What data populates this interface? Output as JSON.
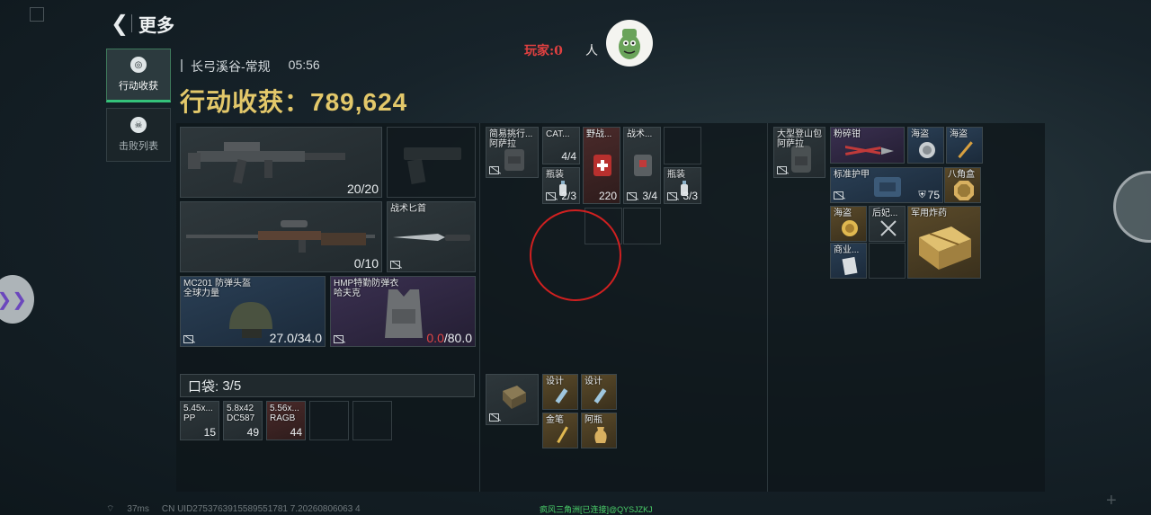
{
  "header": {
    "title": "更多",
    "back_icon": "back-chevron-icon"
  },
  "tabs": [
    {
      "label": "行动收获",
      "icon": "coin-icon",
      "active": true
    },
    {
      "label": "击败列表",
      "icon": "skull-icon",
      "active": false
    }
  ],
  "map_info": {
    "map_name": "长弓溪谷-常规",
    "time": "05:56"
  },
  "haul": {
    "label": "行动收获：",
    "value": "789,624"
  },
  "overlay": {
    "player_label": "玩家:0",
    "player_label2": "人"
  },
  "equipment": {
    "primary_weapon": {
      "count": "20/20"
    },
    "secondary_weapon": {
      "count": ""
    },
    "sniper": {
      "count": "0/10"
    },
    "melee": {
      "name": "战术匕首"
    },
    "helmet": {
      "name_line1": "MC201 防弹头盔",
      "name_line2": "全球力量",
      "durability": "27.0/34.0"
    },
    "armor": {
      "name_line1": "HMP特勤防弹衣",
      "name_line2": "哈夫克",
      "durability_current": "0.0",
      "durability_max": "/80.0"
    }
  },
  "pocket": {
    "label": "口袋:",
    "count": "3/5",
    "items": [
      {
        "name": "5.45x...",
        "sub": "PP",
        "count": "15"
      },
      {
        "name": "5.8x42",
        "sub": "DC587",
        "count": "49"
      },
      {
        "name": "5.56x...",
        "sub": "RAGB",
        "count": "44"
      }
    ]
  },
  "rig": {
    "container_name": "简易挑行...",
    "container_sub": "阿萨拉",
    "items": [
      {
        "name": "CAT...",
        "count": "4/4"
      },
      {
        "name": "野战...",
        "count": "220"
      },
      {
        "name": "战术...",
        "count": "3/4"
      },
      {
        "name": "瓶装",
        "count": "2/3"
      },
      {
        "name": "瓶装",
        "count": "3/3"
      }
    ]
  },
  "safe_box": {
    "items": [
      {
        "name": "设计"
      },
      {
        "name": "设计"
      },
      {
        "name": "金笔"
      },
      {
        "name": "阿瓶"
      }
    ]
  },
  "backpack": {
    "container_name": "大型登山包",
    "container_sub": "阿萨拉",
    "items": [
      {
        "name": "粉碎钳"
      },
      {
        "name": "海盗"
      },
      {
        "name": "海盗"
      },
      {
        "name": "标准护甲",
        "count": "75"
      },
      {
        "name": "八角盒"
      },
      {
        "name": "海盗"
      },
      {
        "name": "后妃..."
      },
      {
        "name": "军用炸药"
      },
      {
        "name": "商业..."
      }
    ]
  },
  "footer": {
    "ping": "37ms",
    "uid": "CN UID2753763915589551781 7.20260806063 4"
  },
  "watermark": "疯风三角洲[已连接]@QYSJZKJ"
}
